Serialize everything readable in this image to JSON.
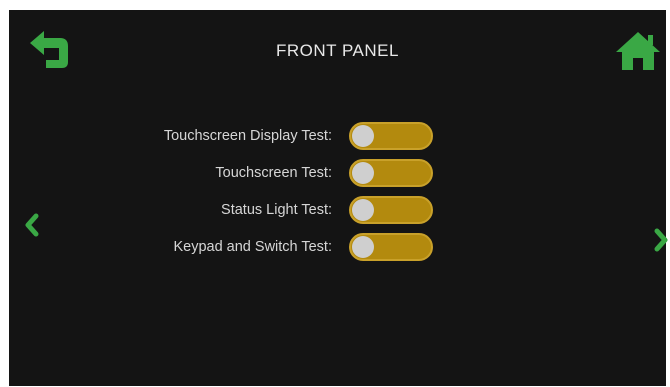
{
  "header": {
    "title": "FRONT PANEL",
    "back_icon": "back-arrow-icon",
    "home_icon": "home-icon"
  },
  "navigation": {
    "prev_icon": "chevron-left-icon",
    "next_icon": "chevron-right-icon"
  },
  "tests": [
    {
      "label": "Touchscreen Display Test:",
      "enabled": false
    },
    {
      "label": "Touchscreen Test:",
      "enabled": false
    },
    {
      "label": "Status Light Test:",
      "enabled": false
    },
    {
      "label": "Keypad and Switch Test:",
      "enabled": false
    }
  ],
  "colors": {
    "background": "#141414",
    "accent_green": "#3aa845",
    "toggle_track": "#b38a0e",
    "toggle_knob": "#cfcfcf",
    "text": "#e6e6e6"
  }
}
